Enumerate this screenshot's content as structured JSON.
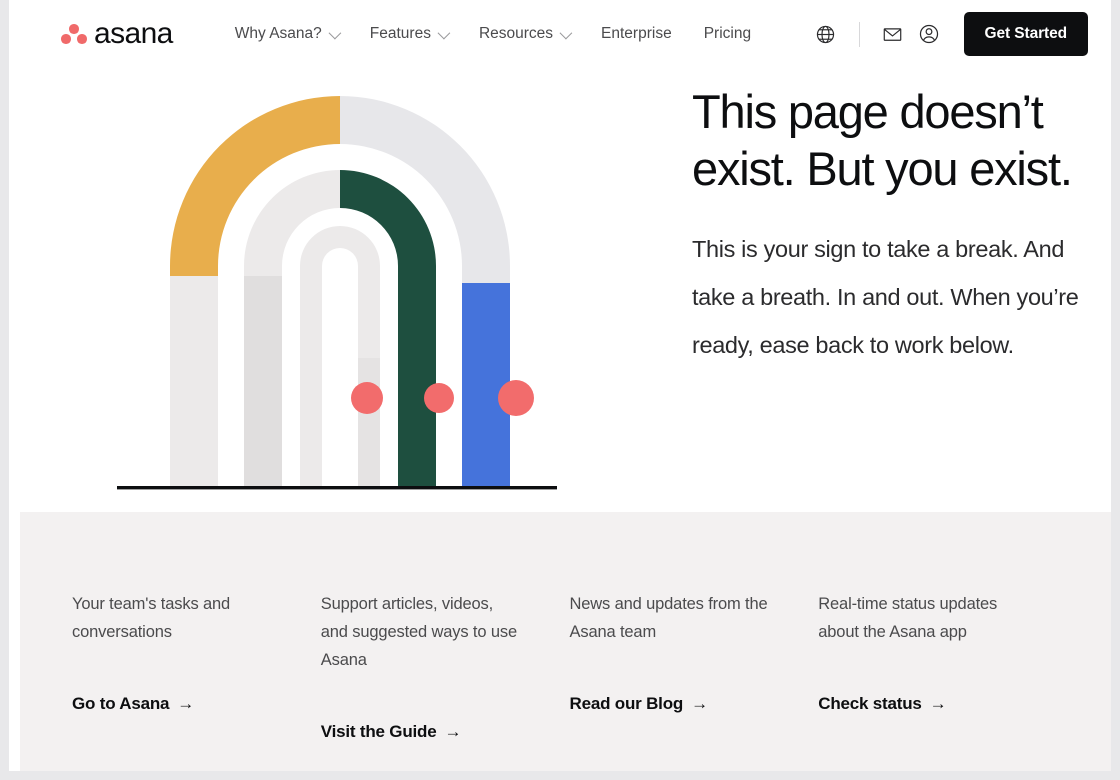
{
  "brand": {
    "name": "asana",
    "dot_color": "#f06a6a",
    "wordmark_color": "#0d0e10"
  },
  "nav": {
    "links": [
      {
        "label": "Why Asana?",
        "has_caret": true
      },
      {
        "label": "Features",
        "has_caret": true
      },
      {
        "label": "Resources",
        "has_caret": true
      },
      {
        "label": "Enterprise",
        "has_caret": false
      },
      {
        "label": "Pricing",
        "has_caret": false
      }
    ],
    "icons": [
      {
        "name": "globe-icon",
        "title": "Language"
      },
      {
        "name": "envelope-icon",
        "title": "Contact"
      },
      {
        "name": "user-account-icon",
        "title": "Log in"
      }
    ],
    "cta_label": "Get Started",
    "cta_bg": "#0d0e10",
    "cta_text_color": "#ffffff"
  },
  "hero": {
    "title": "This page doesn’t exist. But you exist.",
    "subtitle": "This is your sign to take a break. And take a breath. In and out. When you’re ready, ease back to work below."
  },
  "illustration": {
    "name": "nested-arches-illustration",
    "colors": {
      "amber": "#e8ae4c",
      "green": "#1e4f3f",
      "blue": "#4573db",
      "light_gray": "#eceaea",
      "mid_gray": "#e0dede",
      "pale_gray": "#e7e7ea",
      "dot": "#f26c6c",
      "baseline": "#0d0e10"
    },
    "arch_count": 3,
    "dot_count": 3
  },
  "footer": {
    "bg": "#f3f1f1",
    "columns": [
      {
        "desc": "Your team's tasks and conversations",
        "link_label": "Go to Asana",
        "arrow": "→"
      },
      {
        "desc": "Support articles, videos, and suggested ways to use Asana",
        "link_label": "Visit the Guide",
        "arrow": "→"
      },
      {
        "desc": "News and updates from the Asana team",
        "link_label": "Read our Blog",
        "arrow": "→"
      },
      {
        "desc": "Real-time status updates about the Asana app",
        "link_label": "Check status",
        "arrow": "→"
      }
    ]
  }
}
